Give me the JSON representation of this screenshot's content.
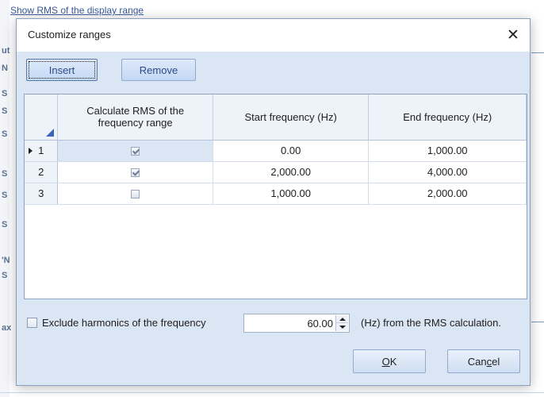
{
  "background": {
    "top_text": "Show RMS of the display range",
    "left_letters": [
      "ut",
      "N",
      "S",
      "S",
      "S",
      "S",
      "S",
      "S",
      "'N",
      "S",
      "ax"
    ]
  },
  "dialog": {
    "title": "Customize ranges",
    "close_symbol": "✕"
  },
  "toolbar": {
    "insert_label": "Insert",
    "remove_label": "Remove"
  },
  "grid": {
    "columns": [
      "Calculate RMS of the frequency range",
      "Start frequency (Hz)",
      "End frequency (Hz)"
    ],
    "rows": [
      {
        "num": "1",
        "checked": true,
        "start": "0.00",
        "end": "1,000.00",
        "current": true
      },
      {
        "num": "2",
        "checked": true,
        "start": "2,000.00",
        "end": "4,000.00",
        "current": false
      },
      {
        "num": "3",
        "checked": false,
        "start": "1,000.00",
        "end": "2,000.00",
        "current": false
      }
    ]
  },
  "harmonics": {
    "label": "Exclude harmonics of the frequency",
    "checked": false,
    "value": "60.00",
    "suffix": "(Hz) from the RMS calculation."
  },
  "buttons": {
    "ok_label": "OK",
    "ok_mnemonic": "O",
    "ok_rest": "K",
    "cancel_pre": "Can",
    "cancel_mnemonic": "c",
    "cancel_post": "el"
  },
  "colors": {
    "dialog_bg": "#dbe6f4",
    "accent": "#3a66b3",
    "selected_cell": "#dbe6f5"
  }
}
